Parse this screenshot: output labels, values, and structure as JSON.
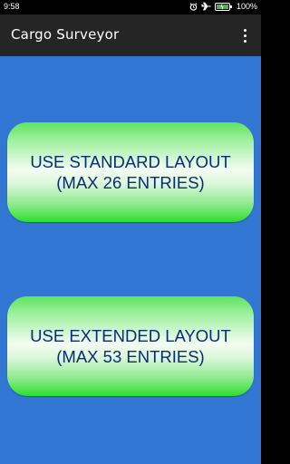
{
  "status_bar": {
    "time": "9:58",
    "battery": "100%"
  },
  "app_bar": {
    "title": "Cargo Surveyor"
  },
  "buttons": {
    "standard": {
      "line1": "USE STANDARD LAYOUT",
      "line2": "(MAX 26 ENTRIES)"
    },
    "extended": {
      "line1": "USE EXTENDED LAYOUT",
      "line2": "(MAX 53 ENTRIES)"
    }
  },
  "colors": {
    "background": "#3176d2",
    "app_bar": "#252525",
    "button_text": "#0c2a78",
    "button_green": "#2ddf2d"
  },
  "icons": [
    "alarm-icon",
    "airplane-icon",
    "battery-icon",
    "overflow-menu-icon"
  ]
}
